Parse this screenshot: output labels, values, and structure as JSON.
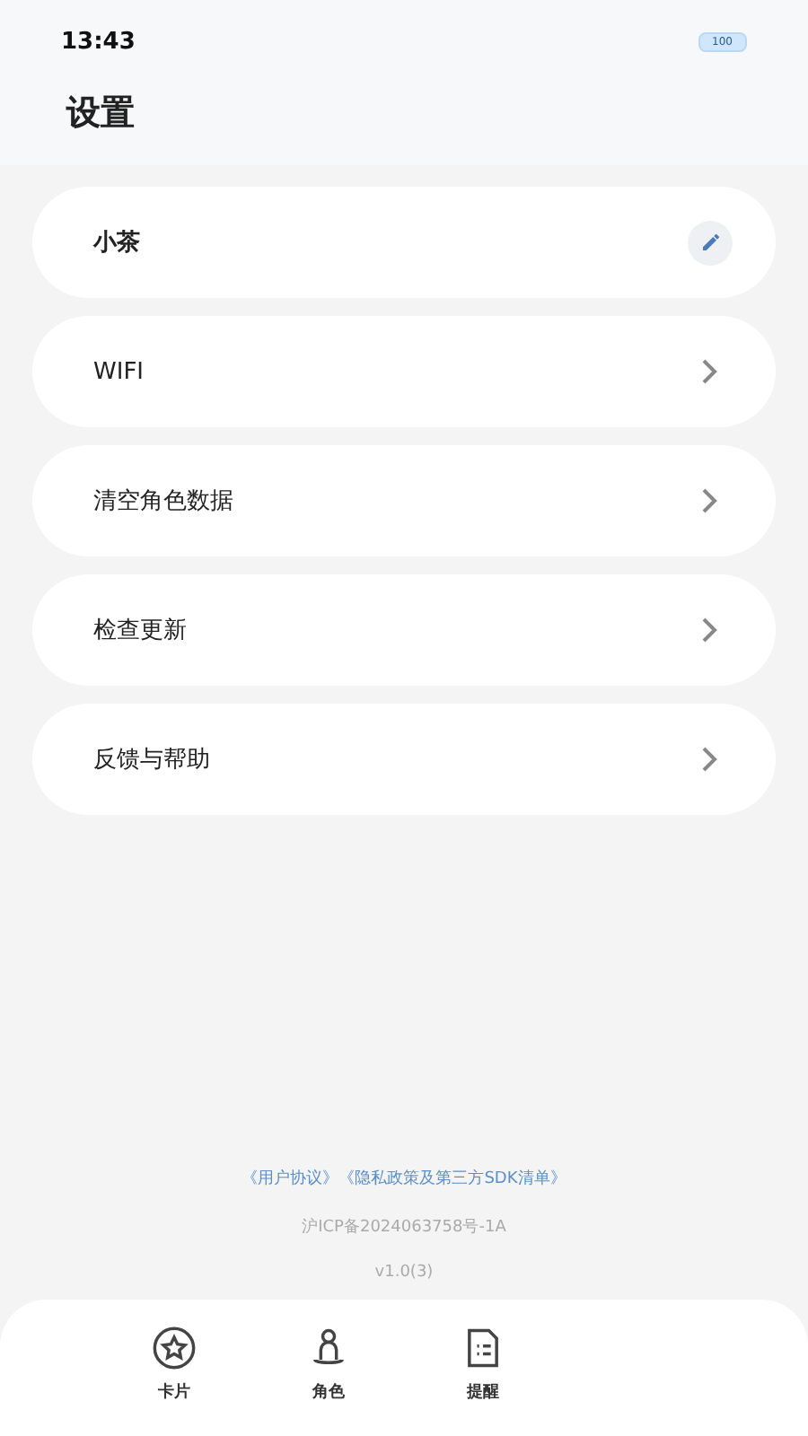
{
  "status_bar": {
    "time": "13:43",
    "battery": "100"
  },
  "header": {
    "title": "设置"
  },
  "settings": [
    {
      "label": "小茶",
      "kind": "edit"
    },
    {
      "label": "WIFI",
      "kind": "link"
    },
    {
      "label": "清空角色数据",
      "kind": "link"
    },
    {
      "label": "检查更新",
      "kind": "link"
    },
    {
      "label": "反馈与帮助",
      "kind": "link"
    }
  ],
  "footer": {
    "links": [
      "《用户协议》",
      "《隐私政策及第三方SDK清单》"
    ],
    "icp": "沪ICP备2024063758号-1A",
    "version": "v1.0(3)"
  },
  "tab_bar": [
    {
      "label": "卡片",
      "kind": "star"
    },
    {
      "label": "角色",
      "kind": "person"
    },
    {
      "label": "提醒",
      "kind": "note"
    }
  ]
}
